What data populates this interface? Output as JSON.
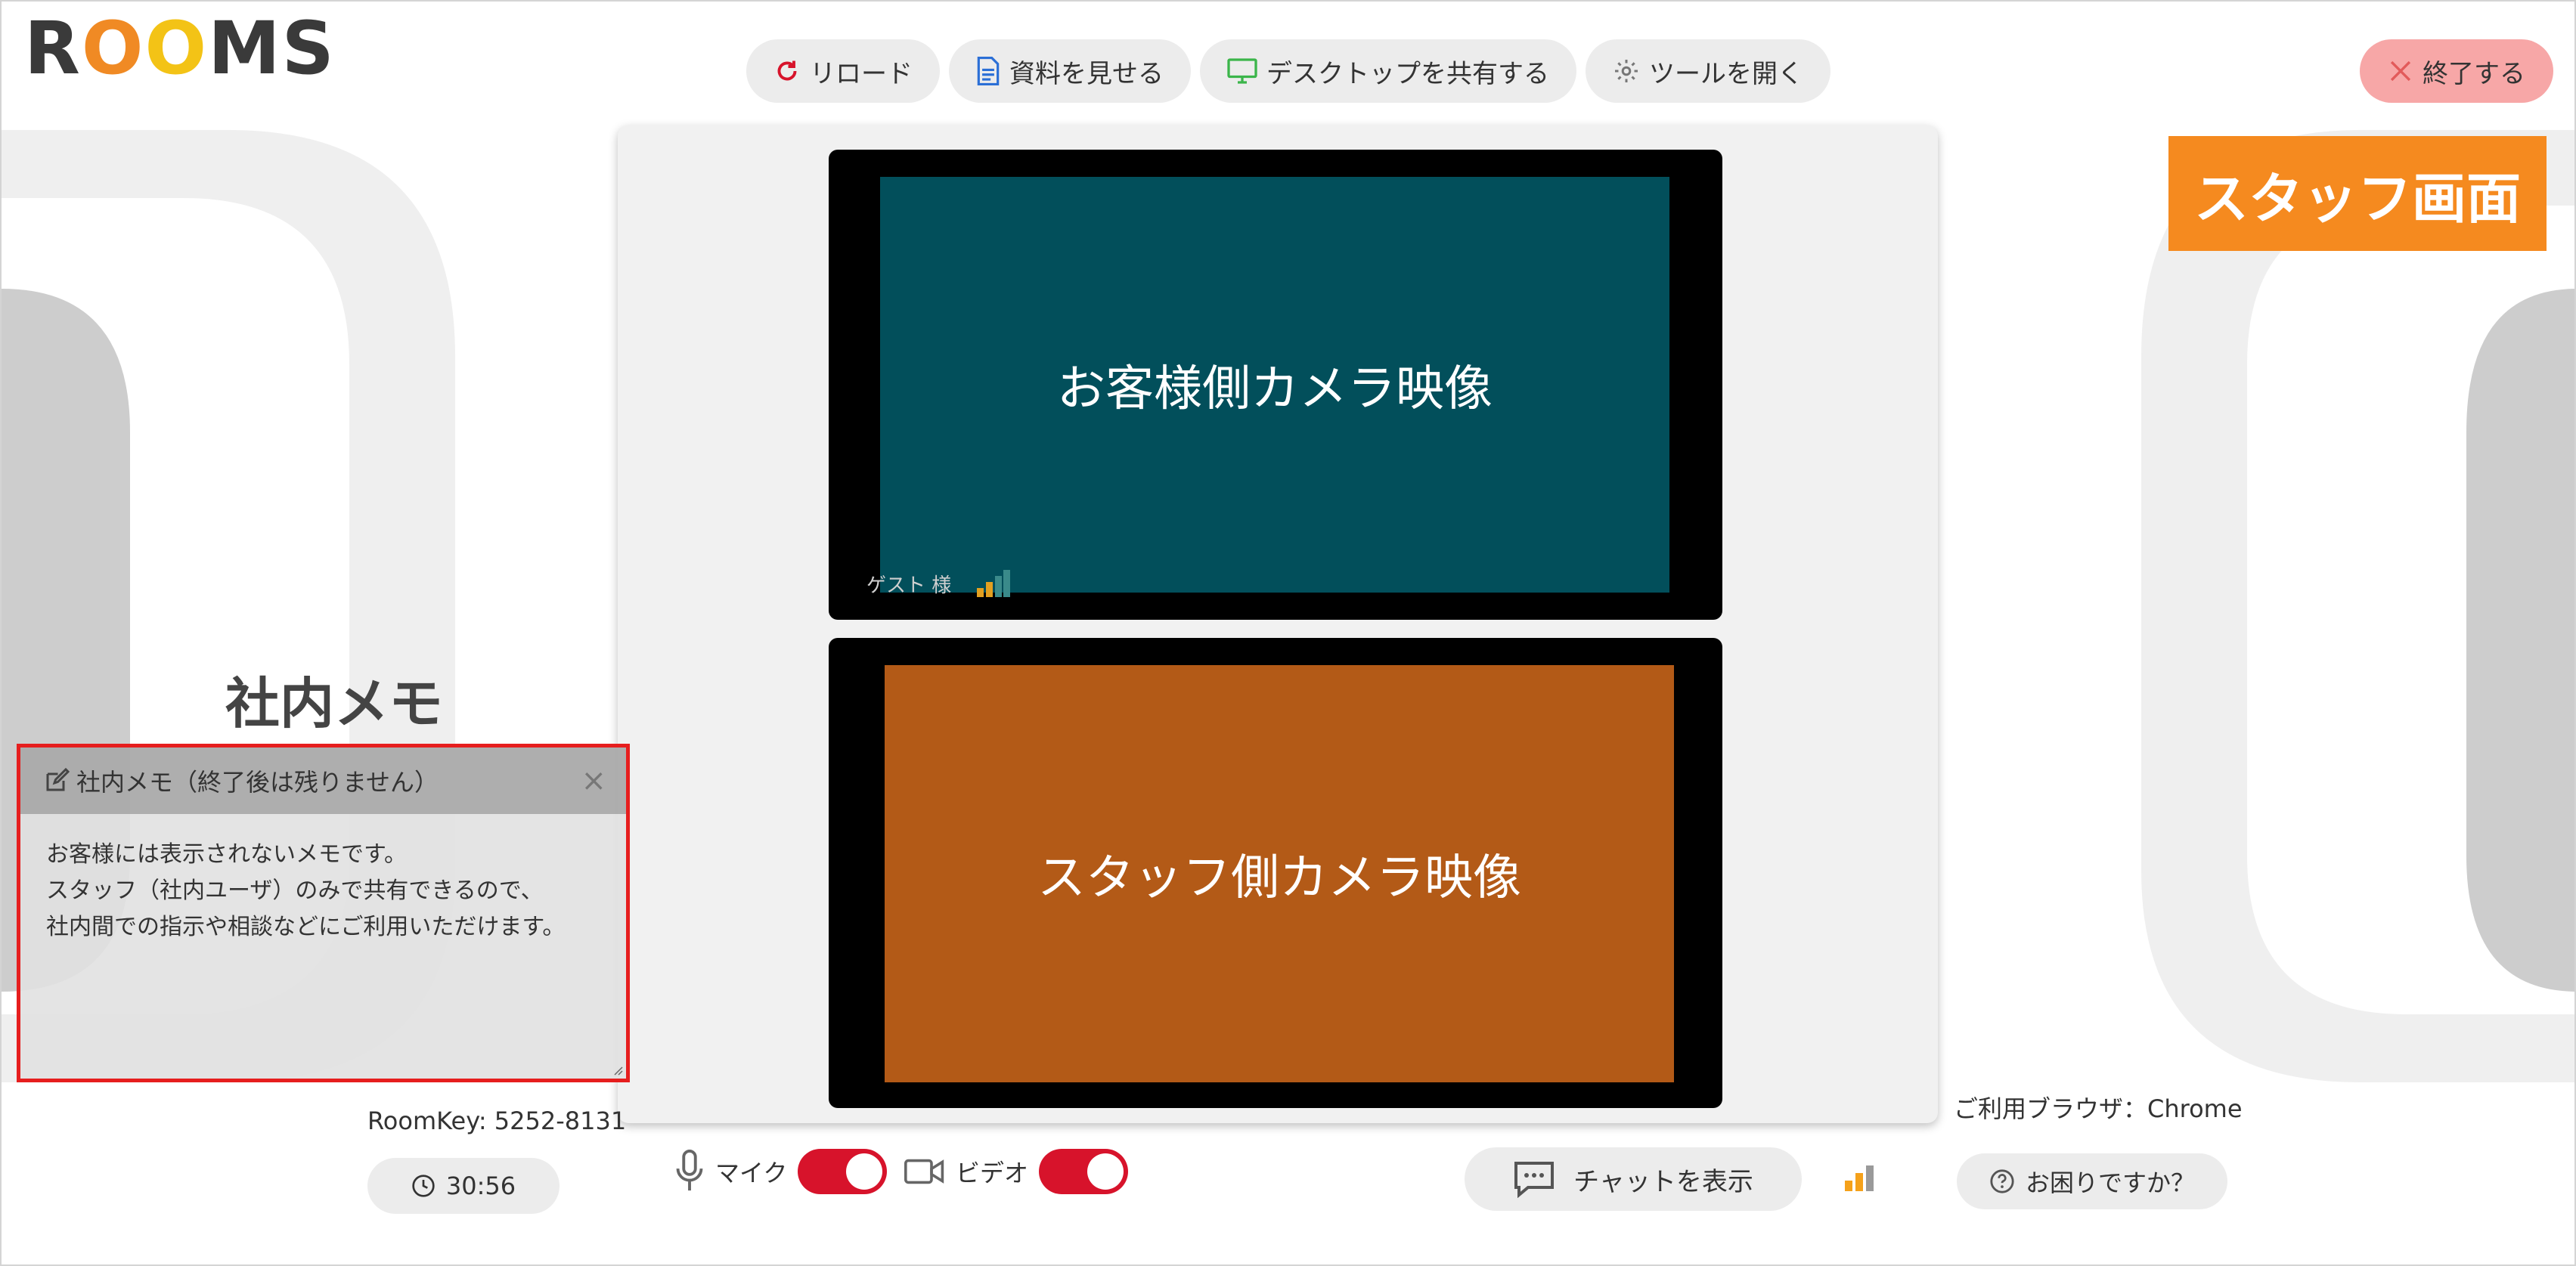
{
  "app": {
    "logo_letters": [
      "R",
      "O",
      "O",
      "M",
      "S"
    ]
  },
  "toolbar": {
    "reload_label": "リロード",
    "show_docs_label": "資料を見せる",
    "share_desktop_label": "デスクトップを共有する",
    "open_tools_label": "ツールを開く",
    "end_label": "終了する"
  },
  "staff_badge": "スタッフ画面",
  "videos": {
    "customer_label": "お客様側カメラ映像",
    "guest_name": "ゲスト 様",
    "staff_label": "スタッフ側カメラ映像"
  },
  "memo": {
    "heading": "社内メモ",
    "panel_title": "社内メモ（終了後は残りません）",
    "close": "×",
    "body_lines": [
      "お客様には表示されないメモです。",
      "スタッフ（社内ユーザ）のみで共有できるので、",
      "社内間での指示や相談などにご利用いただけます。"
    ]
  },
  "session": {
    "roomkey": "RoomKey: 5252-8131",
    "timer": "30:56"
  },
  "controls": {
    "mic_label": "マイク",
    "mic_on": true,
    "video_label": "ビデオ",
    "video_on": true,
    "chat_label": "チャットを表示",
    "browser_text": "ご利用ブラウザ：Chrome",
    "help_label": "お困りですか？"
  },
  "colors": {
    "accent_red": "#d7132b",
    "end_button_bg": "#f7a7a7",
    "staff_badge_bg": "#f58a1f",
    "customer_video_bg": "#024f5b",
    "staff_video_bg": "#b35a17",
    "memo_border": "#e61e1e"
  }
}
